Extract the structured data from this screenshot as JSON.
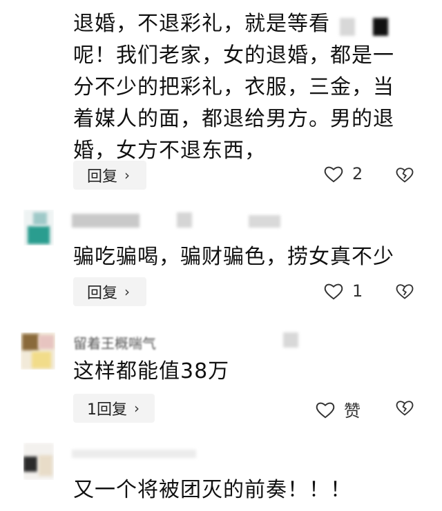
{
  "comments": [
    {
      "lines": [
        "退婚，不退彩礼，就是等看",
        "呢！我们老家，女的退婚，都是一",
        "分不少的把彩礼，衣服，三金，当",
        "着媒人的面，都退给男方。男的退",
        "婚，女方不退东西，"
      ],
      "reply_label": "回复",
      "like_count": "2"
    },
    {
      "text": "骗吃骗喝，骗财骗色，捞女真不少",
      "reply_label": "回复",
      "like_count": "1"
    },
    {
      "username": "留着王概喘气",
      "text": "这样都能值38万",
      "reply_label": "1回复",
      "like_count": "赞"
    },
    {
      "text": "又一个将被团灭的前奏！！！"
    }
  ],
  "colors": {
    "text": "#111111",
    "pill_bg": "#f3f3f3",
    "icon": "#333333"
  },
  "icons": {
    "like": "heart-outline-icon",
    "dislike": "broken-heart-icon",
    "chevron": "chevron-right-icon"
  }
}
